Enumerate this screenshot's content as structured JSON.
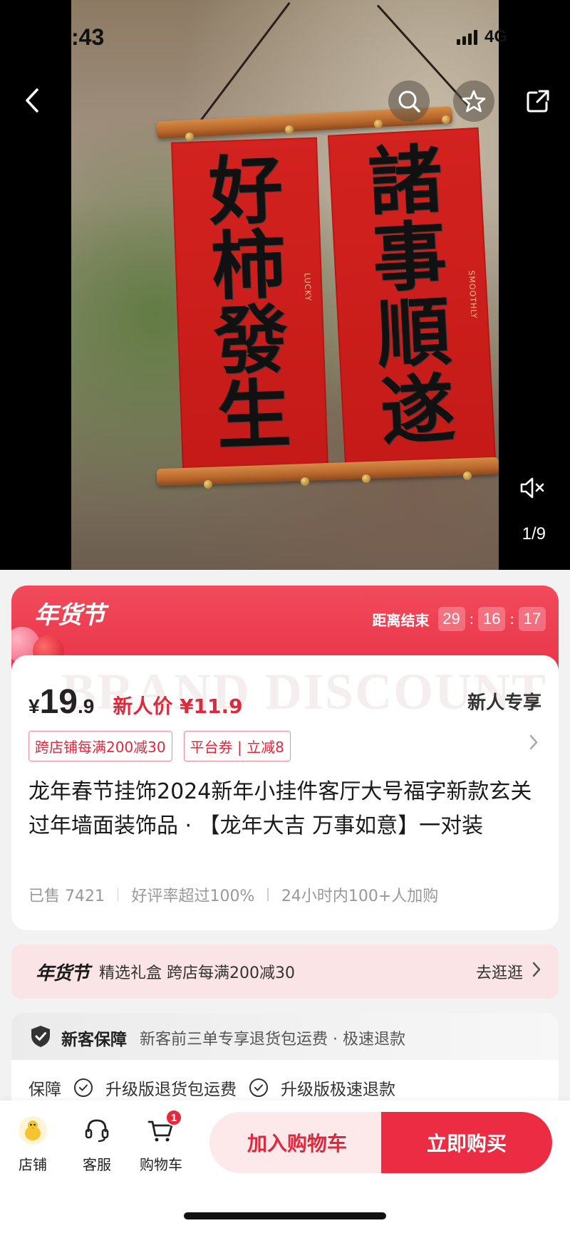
{
  "status_bar": {
    "time": ":43",
    "network": "4G"
  },
  "gallery": {
    "page_indicator": "1/9",
    "left_banner_glyphs": [
      "好",
      "柿",
      "發",
      "生"
    ],
    "right_banner_glyphs": [
      "諸",
      "事",
      "順",
      "遂"
    ],
    "left_banner_tagline": "LUCKY",
    "right_banner_tagline": "SMOOTHLY"
  },
  "promo": {
    "title": "年货节",
    "countdown_label": "距离结束",
    "hours": "29",
    "minutes": "16",
    "seconds": "17",
    "watermark": "BRAND DISCOUNT"
  },
  "product": {
    "currency": "¥",
    "price_int": "19",
    "price_dec": ".9",
    "new_user_price": "新人价 ¥11.9",
    "newbie_tag": "新人专享",
    "coupons": [
      "跨店铺每满200减30",
      "平台券 | 立减8"
    ],
    "title": "龙年春节挂饰2024新年小挂件客厅大号福字新款玄关过年墙面装饰品 · 【龙年大吉 万事如意】一对装",
    "sold": "已售 7421",
    "rating": "好评率超过100%",
    "recent": "24小时内100+人加购"
  },
  "event_bar": {
    "logo": "年货节",
    "text": "精选礼盒 跨店每满200减30",
    "link": "去逛逛"
  },
  "guarantee": {
    "title": "新客保障",
    "text": "新客前三单专享退货包运费 · 极速退款",
    "service_label": "保障",
    "services": [
      "升级版退货包运费",
      "升级版极速退款"
    ]
  },
  "bottom_bar": {
    "store": "店铺",
    "service": "客服",
    "cart": "购物车",
    "cart_count": "1",
    "add_to_cart": "加入购物车",
    "buy_now": "立即购买"
  },
  "colors": {
    "accent": "#ec2c42",
    "accent_light": "#fde8ea"
  }
}
